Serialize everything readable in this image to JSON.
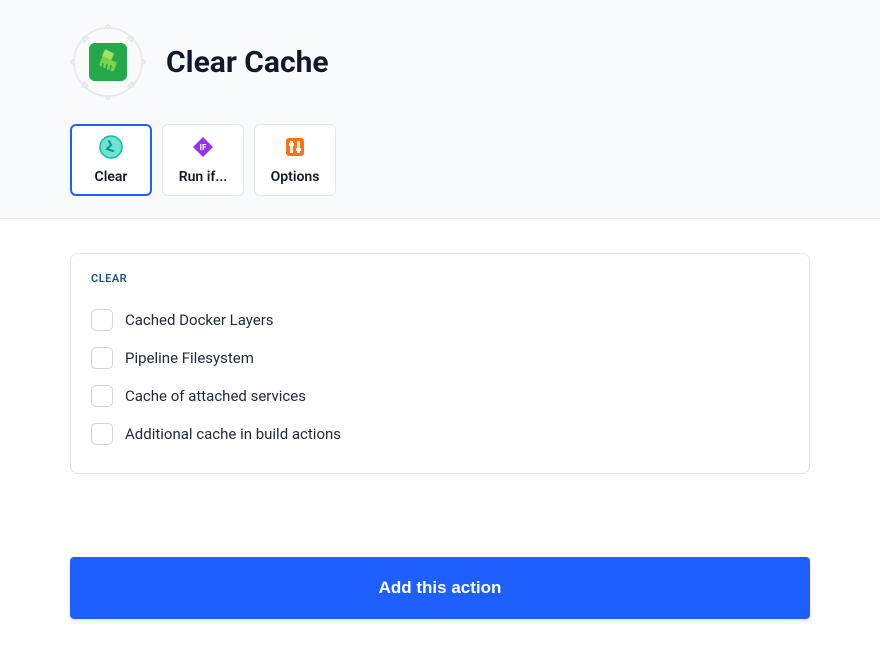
{
  "header": {
    "title": "Clear Cache"
  },
  "tabs": [
    {
      "label": "Clear",
      "active": true,
      "icon": "clear"
    },
    {
      "label": "Run if...",
      "active": false,
      "icon": "runif"
    },
    {
      "label": "Options",
      "active": false,
      "icon": "options"
    }
  ],
  "card": {
    "section_label": "CLEAR",
    "options": [
      {
        "label": "Cached Docker Layers",
        "checked": false
      },
      {
        "label": "Pipeline Filesystem",
        "checked": false
      },
      {
        "label": "Cache of attached services",
        "checked": false
      },
      {
        "label": "Additional cache in build actions",
        "checked": false
      }
    ]
  },
  "footer": {
    "submit_label": "Add this action"
  }
}
